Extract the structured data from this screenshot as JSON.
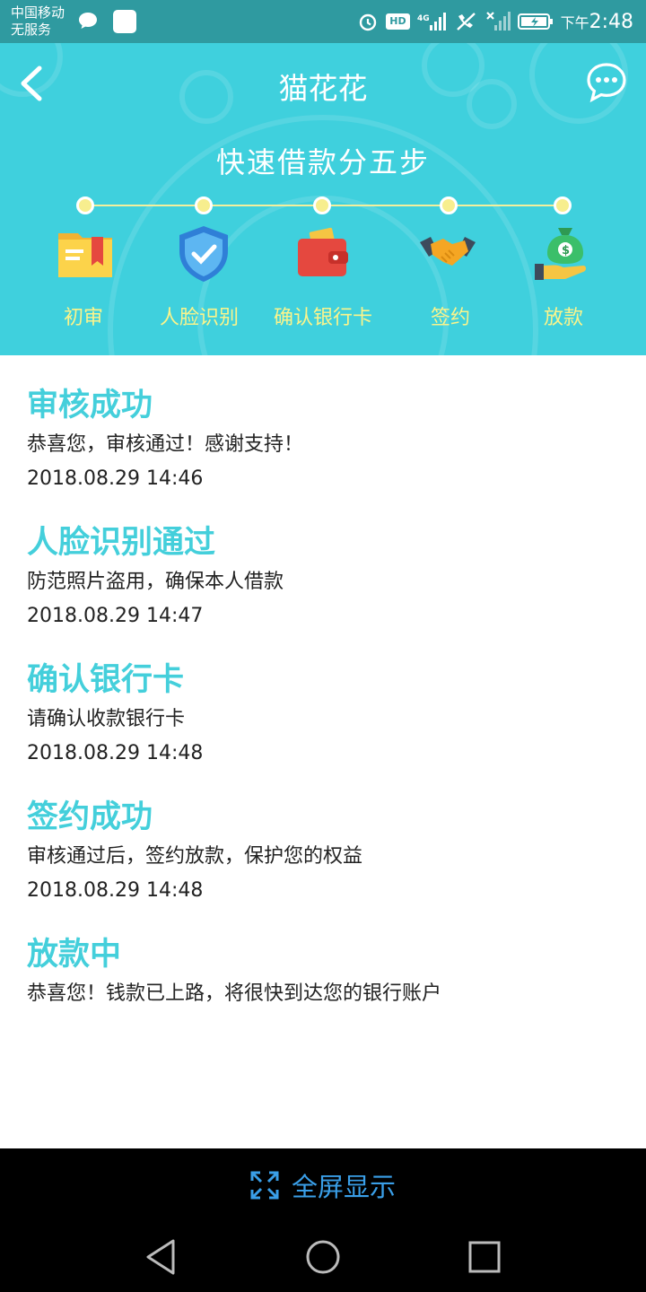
{
  "status_bar": {
    "carrier": "中国移动",
    "carrier_status": "无服务",
    "hd_badge": "HD",
    "network": "4G",
    "time_prefix": "下午",
    "time": "2:48"
  },
  "header": {
    "title": "猫花花",
    "subtitle": "快速借款分五步",
    "steps": [
      {
        "label": "初审",
        "icon": "folder-icon"
      },
      {
        "label": "人脸识别",
        "icon": "shield-check-icon"
      },
      {
        "label": "确认银行卡",
        "icon": "wallet-icon"
      },
      {
        "label": "签约",
        "icon": "handshake-icon"
      },
      {
        "label": "放款",
        "icon": "money-bag-icon"
      }
    ]
  },
  "progress_items": [
    {
      "title": "审核成功",
      "desc": "恭喜您，审核通过！感谢支持！",
      "time": "2018.08.29  14:46"
    },
    {
      "title": "人脸识别通过",
      "desc": "防范照片盗用，确保本人借款",
      "time": "2018.08.29  14:47"
    },
    {
      "title": "确认银行卡",
      "desc": "请确认收款银行卡",
      "time": "2018.08.29  14:48"
    },
    {
      "title": "签约成功",
      "desc": "审核通过后，签约放款，保护您的权益",
      "time": "2018.08.29  14:48"
    },
    {
      "title": "放款中",
      "desc": "恭喜您！钱款已上路，将很快到达您的银行账户",
      "time": ""
    }
  ],
  "fullscreen_bar": {
    "label": "全屏显示"
  },
  "colors": {
    "header_bg": "#3fd0dd",
    "accent": "#44cfdb",
    "step_label": "#fbf48b",
    "status_bg": "#2f9aa0",
    "fullscreen_text": "#3a9fe8"
  }
}
